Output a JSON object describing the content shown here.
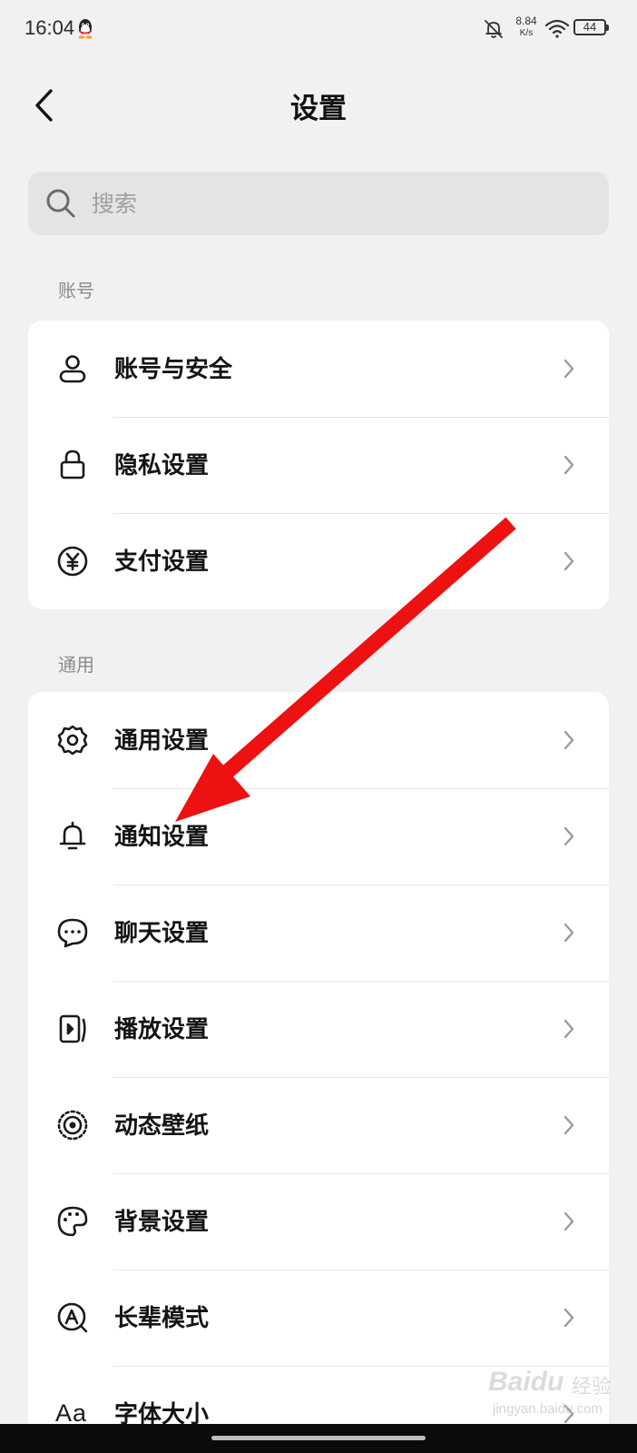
{
  "status_bar": {
    "time": "16:04",
    "net_speed_value": "8.84",
    "net_speed_unit": "K/s",
    "battery": "44",
    "icons": [
      "qq-penguin-icon",
      "bell-off-icon",
      "wifi-icon",
      "battery-icon"
    ]
  },
  "header": {
    "title": "设置",
    "back_icon": "chevron-left-icon"
  },
  "search": {
    "placeholder": "搜索",
    "value": ""
  },
  "sections": [
    {
      "label": "账号",
      "items": [
        {
          "label": "账号与安全",
          "icon": "user-icon"
        },
        {
          "label": "隐私设置",
          "icon": "lock-icon"
        },
        {
          "label": "支付设置",
          "icon": "yen-icon"
        }
      ]
    },
    {
      "label": "通用",
      "items": [
        {
          "label": "通用设置",
          "icon": "gear-icon"
        },
        {
          "label": "通知设置",
          "icon": "bell-icon"
        },
        {
          "label": "聊天设置",
          "icon": "chat-bubble-icon"
        },
        {
          "label": "播放设置",
          "icon": "play-screen-icon"
        },
        {
          "label": "动态壁纸",
          "icon": "live-wallpaper-icon"
        },
        {
          "label": "背景设置",
          "icon": "palette-icon"
        },
        {
          "label": "长辈模式",
          "icon": "elder-mode-icon"
        },
        {
          "label": "字体大小",
          "icon": "font-size-icon",
          "icon_text": "Aa"
        }
      ]
    }
  ],
  "annotation": {
    "type": "red-arrow",
    "color": "#ee1111",
    "points_to": "通知设置"
  },
  "watermark": {
    "brand": "Baidu",
    "suffix": "经验",
    "url": "jingyan.baidu.com"
  },
  "colors": {
    "background": "#f1f1f3",
    "card": "#ffffff",
    "search_bg": "#e4e4e6",
    "section_label": "#8a8a8e",
    "arrow": "#ee1111"
  }
}
